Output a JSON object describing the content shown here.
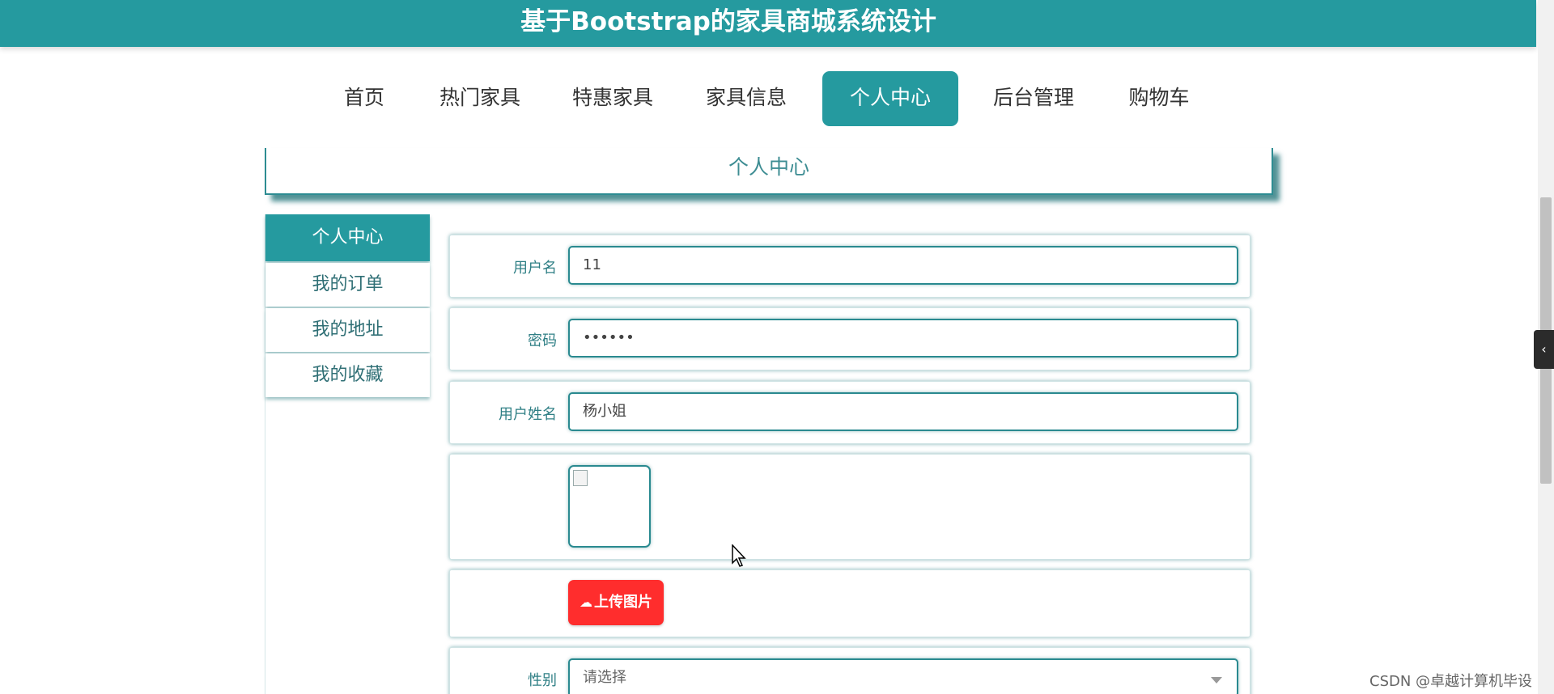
{
  "header": {
    "title": "基于Bootstrap的家具商城系统设计"
  },
  "nav": {
    "items": [
      {
        "label": "首页",
        "active": false
      },
      {
        "label": "热门家具",
        "active": false
      },
      {
        "label": "特惠家具",
        "active": false
      },
      {
        "label": "家具信息",
        "active": false
      },
      {
        "label": "个人中心",
        "active": true
      },
      {
        "label": "后台管理",
        "active": false
      },
      {
        "label": "购物车",
        "active": false
      }
    ]
  },
  "page_heading": "个人中心",
  "sidebar": {
    "items": [
      {
        "label": "个人中心",
        "active": true
      },
      {
        "label": "我的订单",
        "active": false
      },
      {
        "label": "我的地址",
        "active": false
      },
      {
        "label": "我的收藏",
        "active": false
      }
    ]
  },
  "form": {
    "username": {
      "label": "用户名",
      "value": "11"
    },
    "password": {
      "label": "密码",
      "value": "••••••"
    },
    "fullname": {
      "label": "用户姓名",
      "value": "杨小姐"
    },
    "upload_label": "上传图片",
    "gender": {
      "label": "性别",
      "placeholder": "请选择"
    }
  },
  "watermark": "CSDN @卓越计算机毕设",
  "colors": {
    "primary": "#259a9f",
    "upload": "#ff2d2d"
  },
  "icons": {
    "upload": "cloud-upload-icon",
    "handle": "chevron-left-icon"
  }
}
